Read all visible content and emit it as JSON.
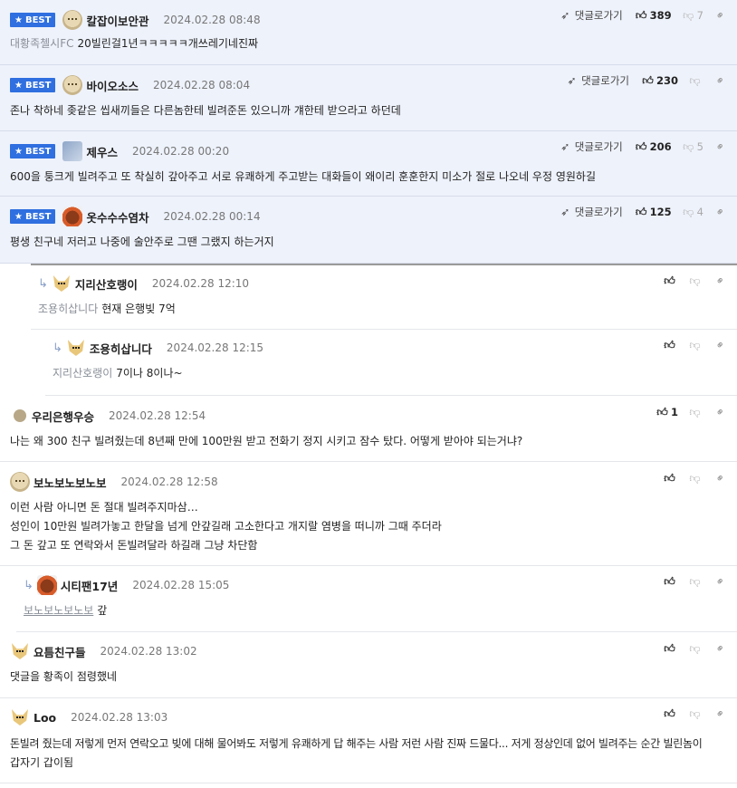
{
  "best_label": "BEST",
  "reply_go_label": "댓글로가기",
  "comments": [
    {
      "nick": "칼잡이보안관",
      "date": "2024.02.28 08:48",
      "mention": "대황족첼시FC",
      "text": "20빌린걸1년ㅋㅋㅋㅋㅋ개쓰레기네진짜",
      "up": "389",
      "down": "7"
    },
    {
      "nick": "바이오소스",
      "date": "2024.02.28 08:04",
      "mention": "",
      "text": "존나 착하네 좆같은 씹새끼들은 다른놈한테 빌려준돈 있으니까 걔한테 받으라고 하던데",
      "up": "230",
      "down": ""
    },
    {
      "nick": "제우스",
      "date": "2024.02.28 00:20",
      "mention": "",
      "text": "600을 퉁크게 빌려주고 또 착실히 갚아주고 서로 유쾌하게 주고받는 대화들이 왜이리 훈훈한지 미소가 절로 나오네 우정 영원하길",
      "up": "206",
      "down": "5"
    },
    {
      "nick": "옷수수수염차",
      "date": "2024.02.28 00:14",
      "mention": "",
      "text": "평생 친구네 저러고 나중에 술안주로 그땐 그랬지 하는거지",
      "up": "125",
      "down": "4"
    },
    {
      "nick": "지리산호랭이",
      "date": "2024.02.28 12:10",
      "mention": "조용히삽니다",
      "text": "현재 은행빚 7억",
      "up": "",
      "down": ""
    },
    {
      "nick": "조용히삽니다",
      "date": "2024.02.28 12:15",
      "mention": "지리산호랭이",
      "text": "7이나 8이나~",
      "up": "",
      "down": ""
    },
    {
      "nick": "우리은행우승",
      "date": "2024.02.28 12:54",
      "mention": "",
      "text": "나는 왜 300 친구 빌려줬는데 8년째 만에 100만원 받고 전화기 정지 시키고 잠수 탔다. 어떻게 받아야 되는거냐?",
      "up": "1",
      "down": ""
    },
    {
      "nick": "보노보노보노보",
      "date": "2024.02.28 12:58",
      "mention": "",
      "lines": [
        "이런 사람 아니면 돈 절대 빌려주지마삼…",
        "성인이 10만원 빌려가놓고 한달을 넘게 안갚길래 고소한다고 개지랄 염병을 떠니까 그때 주더라",
        "그 돈 갚고 또 연락와서 돈빌려달라 하길래 그냥 차단함"
      ],
      "up": "",
      "down": ""
    },
    {
      "nick": "시티팬17년",
      "date": "2024.02.28 15:05",
      "mention": "보노보노보노보",
      "text": "갚",
      "up": "",
      "down": ""
    },
    {
      "nick": "요틈친구들",
      "date": "2024.02.28 13:02",
      "mention": "",
      "text": "댓글을 황족이 점령했네",
      "up": "",
      "down": ""
    },
    {
      "nick": "Loo",
      "date": "2024.02.28 13:03",
      "mention": "",
      "lines": [
        "돈빌려 줬는데 저렇게 먼저 연락오고 빚에 대해 물어봐도 저렇게 유쾌하게 답 해주는 사람 저런 사람 진짜 드물다... 저게 정상인데 없어 빌려주는 순간 빌린놈이",
        "갑자기 갑이됨"
      ],
      "up": "",
      "down": ""
    }
  ]
}
